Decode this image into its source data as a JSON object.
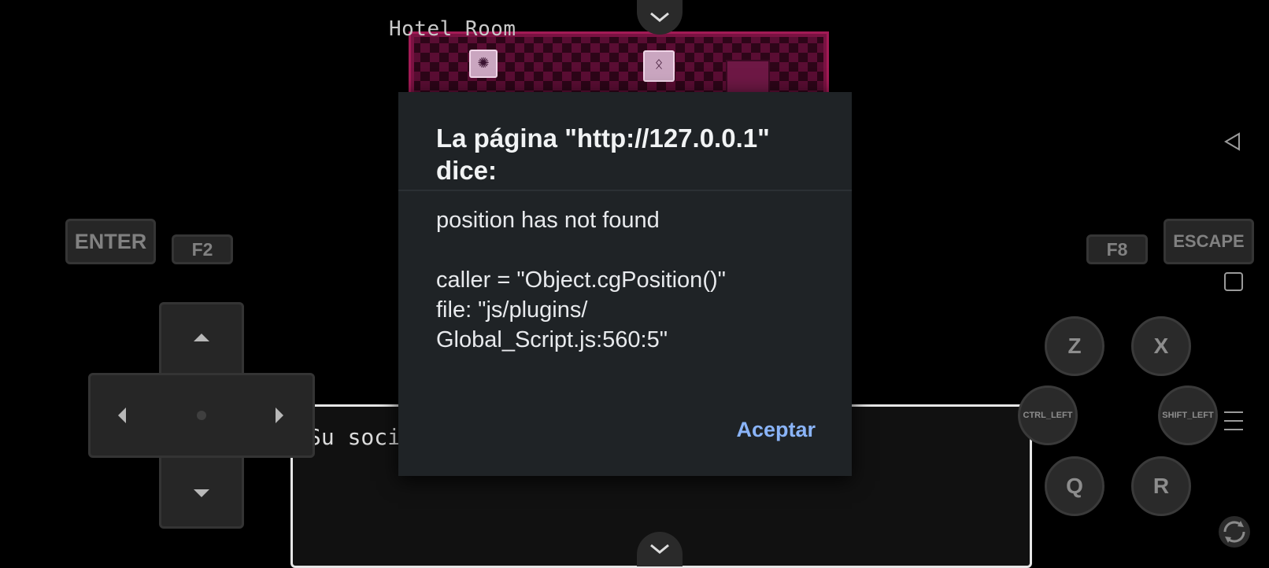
{
  "game": {
    "map_name": "Hotel Room",
    "message_text": "Su soci"
  },
  "dialog": {
    "title": "La página \"http://127.0.0.1\" dice:",
    "message_lines": [
      "position has not found",
      "",
      "caller = \"Object.cgPosition()\"",
      "file: \"js/plugins/",
      "Global_Script.js:560:5\""
    ],
    "ok_button": "Aceptar"
  },
  "controls": {
    "enter": "ENTER",
    "f2": "F2",
    "f8": "F8",
    "escape": "ESCAPE",
    "z": "Z",
    "x": "X",
    "ctrl_left": "CTRL_LEFT",
    "shift_left": "SHIFT_LEFT",
    "q": "Q",
    "r": "R"
  },
  "icons": {
    "collapse_top": "chevron-down-icon",
    "collapse_bottom": "chevron-down-icon",
    "nav_back": "triangle-left-icon",
    "nav_recents": "square-icon",
    "menu": "hamburger-menu-icon",
    "rotate": "rotate-icon"
  }
}
